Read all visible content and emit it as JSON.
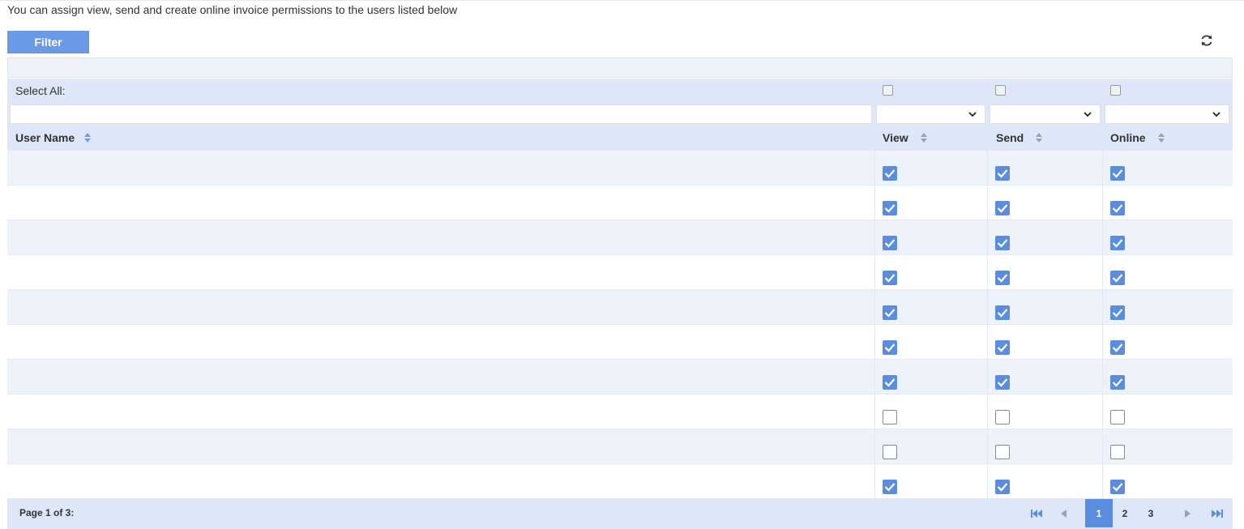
{
  "intro_text": "You can assign view, send and create online invoice permissions to the users listed below",
  "filter_label": "Filter",
  "select_all_label": "Select All:",
  "columns": {
    "user_name": "User Name",
    "view": "View",
    "send": "Send",
    "online": "Online"
  },
  "rows": [
    {
      "name": "",
      "view": true,
      "send": true,
      "online": true
    },
    {
      "name": "",
      "view": true,
      "send": true,
      "online": true
    },
    {
      "name": "",
      "view": true,
      "send": true,
      "online": true
    },
    {
      "name": "",
      "view": true,
      "send": true,
      "online": true
    },
    {
      "name": "",
      "view": true,
      "send": true,
      "online": true
    },
    {
      "name": "",
      "view": true,
      "send": true,
      "online": true
    },
    {
      "name": "",
      "view": true,
      "send": true,
      "online": true
    },
    {
      "name": "",
      "view": false,
      "send": false,
      "online": false
    },
    {
      "name": "",
      "view": false,
      "send": false,
      "online": false
    },
    {
      "name": "",
      "view": true,
      "send": true,
      "online": true
    }
  ],
  "pagination": {
    "info": "Page 1 of 3:",
    "pages": [
      "1",
      "2",
      "3"
    ],
    "current_page": 1
  },
  "colors": {
    "accent": "#5b8dde",
    "header_bg": "#dde7f7",
    "row_alt": "#eef3fb"
  }
}
